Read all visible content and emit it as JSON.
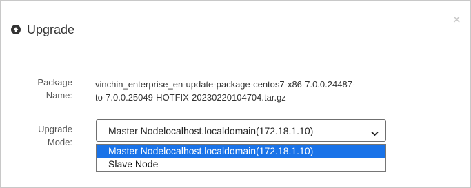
{
  "dialog": {
    "title": "Upgrade",
    "close_symbol": "×",
    "header_icon": "circle-up-arrow-icon",
    "package_name": {
      "label_line1": "Package",
      "label_line2": "Name:",
      "value_line1": "vinchin_enterprise_en-update-package-centos7-x86-7.0.0.24487-",
      "value_line2": "to-7.0.0.25049-HOTFIX-20230220104704.tar.gz"
    },
    "upgrade_mode": {
      "label_line1": "Upgrade",
      "label_line2": "Mode:",
      "selected": "Master Nodelocalhost.localdomain(172.18.1.10)",
      "options": [
        "Master Nodelocalhost.localdomain(172.18.1.10)",
        "Slave Node"
      ]
    },
    "colors": {
      "highlight": "#1a73e8",
      "border": "#c8c8c8"
    }
  }
}
